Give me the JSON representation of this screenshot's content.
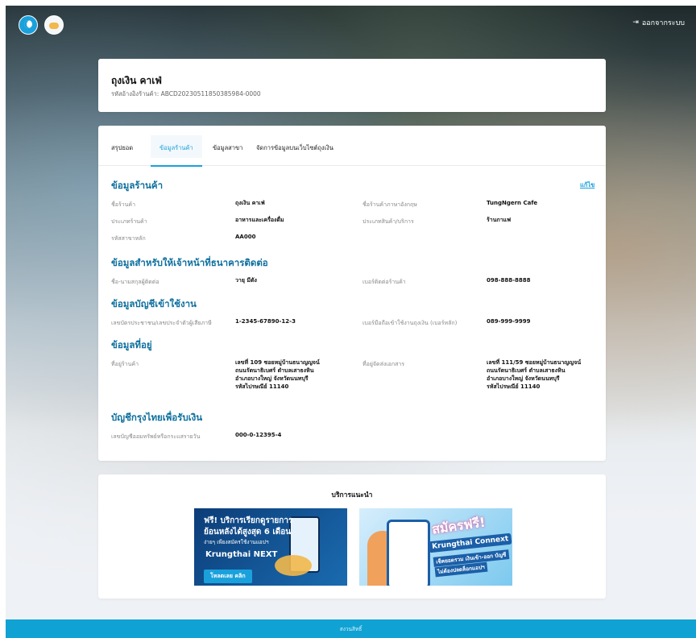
{
  "header": {
    "logout_label": "ออกจากระบบ"
  },
  "store": {
    "name": "ถุงเงิน คาเฟ่",
    "ref_id": "รหัสอ้างอิงร้านค้า: ABCD20230511850385984-0000"
  },
  "tabs": [
    {
      "label": "สรุปยอด"
    },
    {
      "label": "ข้อมูลร้านค้า"
    },
    {
      "label": "ข้อมูลสาขา"
    },
    {
      "label": "จัดการข้อมูลบนเว็บไซต์ถุงเงิน"
    }
  ],
  "sections": {
    "store_info": {
      "title": "ข้อมูลร้านค้า",
      "edit_label": "แก้ไข",
      "store_name_label": "ชื่อร้านค้า",
      "store_name_value": "ถุงเงิน คาเฟ่",
      "store_name_en_label": "ชื่อร้านค้าภาษาอังกฤษ",
      "store_name_en_value": "TungNgern Cafe",
      "store_type_label": "ประเภทร้านค้า",
      "store_type_value": "อาหารและเครื่องดื่ม",
      "product_type_label": "ประเภทสินค้า/บริการ",
      "product_type_value": "ร้านกาแฟ",
      "main_branch_label": "รหัสสาขาหลัก",
      "main_branch_value": "AA000"
    },
    "contact": {
      "title": "ข้อมูลสำหรับให้เจ้าหน้าที่ธนาคารติดต่อ",
      "name_label": "ชื่อ-นามสกุลผู้ติดต่อ",
      "name_value": "วายุ มีตัง",
      "phone_label": "เบอร์ติดต่อร้านค้า",
      "phone_value": "098-888-8888"
    },
    "account": {
      "title": "ข้อมูลบัญชีเข้าใช้งาน",
      "id_label": "เลขบัตรประชาชน/เลขประจำตัวผู้เสียภาษี",
      "id_value": "1-2345-67890-12-3",
      "mobile_label": "เบอร์มือถือเข้าใช้งานถุงเงิน (เบอร์หลัก)",
      "mobile_value": "089-999-9999"
    },
    "address": {
      "title": "ข้อมูลที่อยู่",
      "store_address_label": "ที่อยู่ร้านค้า",
      "store_address_lines": [
        "เลขที่ 109 ซอยหมู่บ้านธนาญญจน์",
        "ถนนรัตนาธิเบศร์ ตำบลเสาธงหิน",
        "อำเภอบางใหญ่ จังหวัดนนทบุรี",
        "รหัสไปรษณีย์ 11140"
      ],
      "doc_address_label": "ที่อยู่จัดส่งเอกสาร",
      "doc_address_lines": [
        "เลขที่ 111/59 ซอยหมู่บ้านธนาญญจน์",
        "ถนนรัตนาธิเบศร์ ตำบลเสาธงหิน",
        "อำเภอบางใหญ่ จังหวัดนนทบุรี",
        "รหัสไปรษณีย์ 11140"
      ]
    },
    "bank": {
      "title": "บัญชีกรุงไทยเพื่อรับเงิน",
      "account_label": "เลขบัญชีออมทรัพย์หรือกระแสรายวัน",
      "account_value": "000-0-12395-4"
    }
  },
  "services": {
    "title": "บริการแนะนำ",
    "banner1": {
      "line1": "ฟรี! บริการเรียกดูรายการ",
      "line2": "ย้อนหลังได้สูงสุด 6 เดือน",
      "line3": "ง่ายๆ เพียงสมัครใช้งานแอปฯ",
      "logo": "Krungthai NEXT",
      "button": "โหลดเลย คลิก"
    },
    "banner2": {
      "line1": "สมัครฟรี!",
      "line2": "Krungthai Connext",
      "line3": "เช็คยอดรวม เงินเข้า-ออก บัญชี",
      "line4": "ไม่ต้องปลดล็อกแอปฯ"
    }
  },
  "footer": {
    "text": "สงวนสิทธิ์"
  },
  "colors": {
    "accent": "#1aa1dc",
    "section_title": "#0d6f9e",
    "footer": "#0fa2d3"
  }
}
